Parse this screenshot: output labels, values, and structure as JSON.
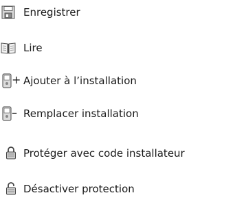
{
  "menu": {
    "items": [
      {
        "label": "Enregistrer",
        "icon": "floppy-disk-icon"
      },
      {
        "label": "Lire",
        "icon": "open-book-icon"
      },
      {
        "label": "Ajouter à l’installation",
        "icon": "device-add-icon",
        "symbol": "+"
      },
      {
        "label": "Remplacer installation",
        "icon": "device-remove-icon",
        "symbol": "–"
      },
      {
        "label": "Protéger avec code installateur",
        "icon": "padlock-locked-icon"
      },
      {
        "label": "Désactiver protection",
        "icon": "padlock-unlocked-icon"
      }
    ]
  }
}
